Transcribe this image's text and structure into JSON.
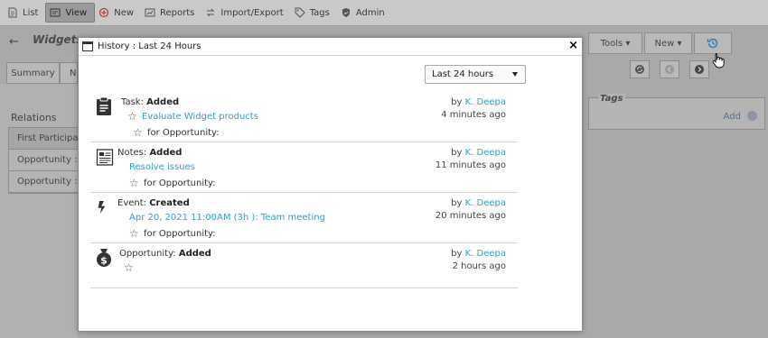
{
  "nav": {
    "items": [
      {
        "label": "List",
        "icon": "document-icon"
      },
      {
        "label": "View",
        "icon": "card-icon",
        "active": true
      },
      {
        "label": "New",
        "icon": "plus-circle-icon"
      },
      {
        "label": "Reports",
        "icon": "chart-icon"
      },
      {
        "label": "Import/Export",
        "icon": "swap-icon"
      },
      {
        "label": "Tags",
        "icon": "tag-icon"
      },
      {
        "label": "Admin",
        "icon": "shield-icon"
      }
    ]
  },
  "page": {
    "title": "Widgets",
    "tabs": [
      "Summary",
      "N"
    ],
    "relations_title": "Relations",
    "relations_rows": [
      "First Participant",
      "Opportunity : W",
      "Opportunity : W"
    ],
    "toolbar": {
      "tools": "Tools ▾",
      "new": "New ▾"
    },
    "tags_title": "Tags",
    "tags_add": "Add"
  },
  "modal": {
    "title": "History : Last 24 Hours",
    "close": "×",
    "filter_value": "Last 24 hours",
    "entries": [
      {
        "icon": "clipboard-icon",
        "type_prefix": "Task: ",
        "type_action": "Added",
        "link": "Evaluate Widget products",
        "for": "for Opportunity:",
        "by_prefix": "by ",
        "by": "K. Deepa",
        "time": "4 minutes ago"
      },
      {
        "icon": "notes-icon",
        "type_prefix": "Notes: ",
        "type_action": "Added",
        "link": "Resolve issues",
        "for": "for Opportunity:",
        "by_prefix": "by ",
        "by": "K. Deepa",
        "time": "11 minutes ago"
      },
      {
        "icon": "lightning-icon",
        "type_prefix": "Event: ",
        "type_action": "Created",
        "link": "Apr 20, 2021 11:00AM (3h ): Team meeting",
        "for": "for Opportunity:",
        "by_prefix": "by ",
        "by": "K. Deepa",
        "time": "20 minutes ago"
      },
      {
        "icon": "money-bag-icon",
        "type_prefix": "Opportunity: ",
        "type_action": "Added",
        "link": "",
        "for": "",
        "by_prefix": "by ",
        "by": "K. Deepa",
        "time": "2 hours ago"
      }
    ]
  },
  "colors": {
    "link": "#2a9fd8",
    "overlay": "#a9a9a9"
  }
}
